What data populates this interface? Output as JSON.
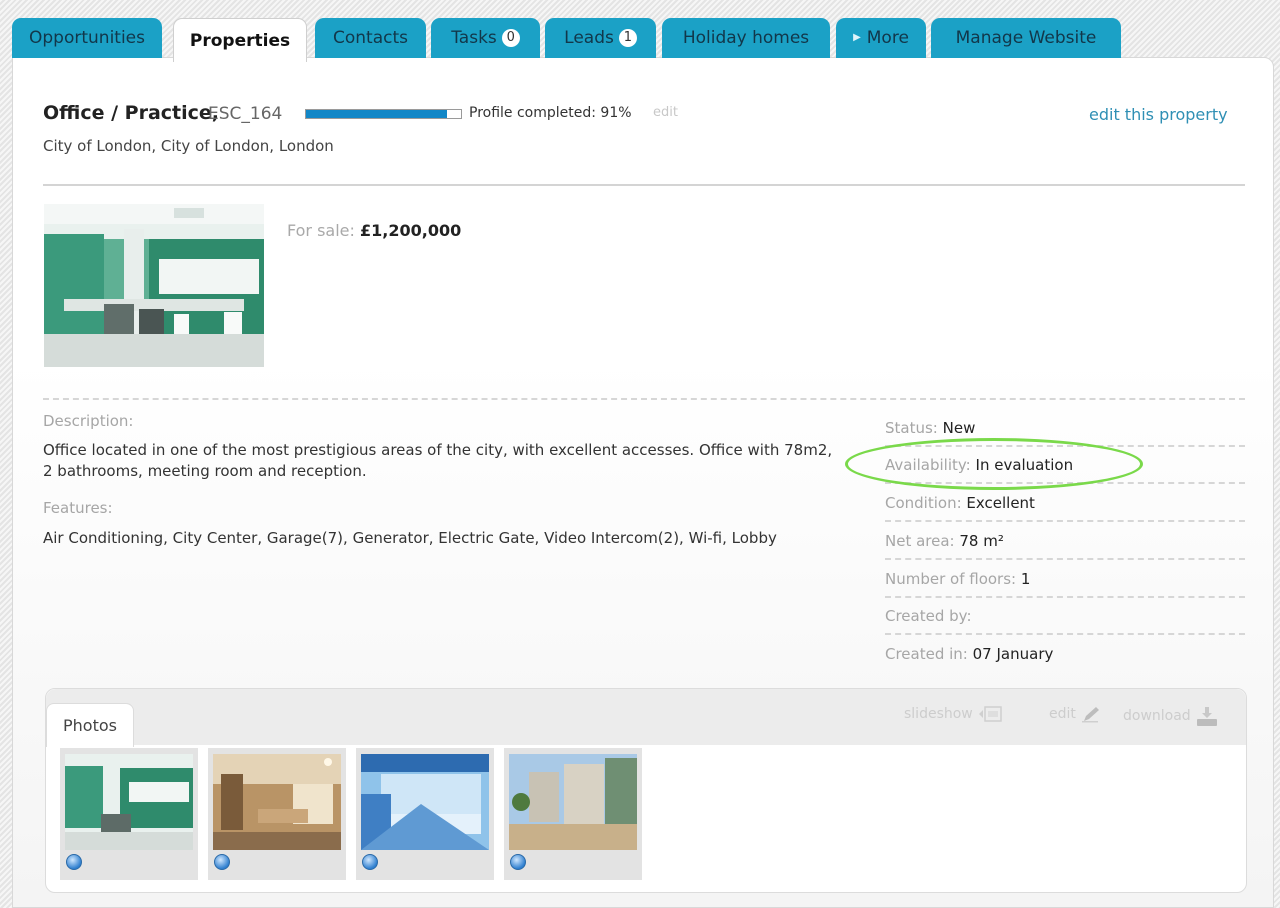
{
  "tabs": [
    {
      "label": "Opportunities"
    },
    {
      "label": "Properties"
    },
    {
      "label": "Contacts"
    },
    {
      "label": "Tasks",
      "count": "0"
    },
    {
      "label": "Leads",
      "count": "1"
    },
    {
      "label": "Holiday homes"
    },
    {
      "label": "More"
    },
    {
      "label": "Manage Website"
    }
  ],
  "property": {
    "title": "Office / Practice,",
    "code": "ESC_164",
    "profile_text": "Profile completed: 91%",
    "profile_completed": 0.91,
    "profile_edit": "edit",
    "edit_link": "edit this property",
    "location": "City of London, City of London, London",
    "sale_label": "For sale:",
    "price": "£1,200,000",
    "description_label": "Description:",
    "description": "Office located in one of the most prestigious areas of the city, with excellent accesses. Office with 78m2, 2 bathrooms, meeting room and reception.",
    "features_label": "Features:",
    "features": "Air Conditioning, City Center, Garage(7), Generator, Electric Gate, Video Intercom(2), Wi-fi, Lobby"
  },
  "details": [
    {
      "label": "Status:",
      "value": "New"
    },
    {
      "label": "Availability:",
      "value": "In evaluation"
    },
    {
      "label": "Condition:",
      "value": "Excellent"
    },
    {
      "label": "Net area:",
      "value": "78 m²"
    },
    {
      "label": "Number of floors:",
      "value": "1"
    },
    {
      "label": "Created by:",
      "value": ""
    },
    {
      "label": "Created in:",
      "value": "07 January"
    }
  ],
  "photos": {
    "tab_label": "Photos",
    "slideshow_label": "slideshow",
    "edit_label": "edit",
    "download_label": "download"
  },
  "colors": {
    "tab_bg": "#1ba1c6",
    "link": "#2f8fb4",
    "progress": "#1287c7",
    "highlight": "#7ad94a"
  },
  "icons": [
    "zoom-icon",
    "slideshow-icon",
    "pencil-icon",
    "download-icon",
    "arrow-right-icon"
  ]
}
